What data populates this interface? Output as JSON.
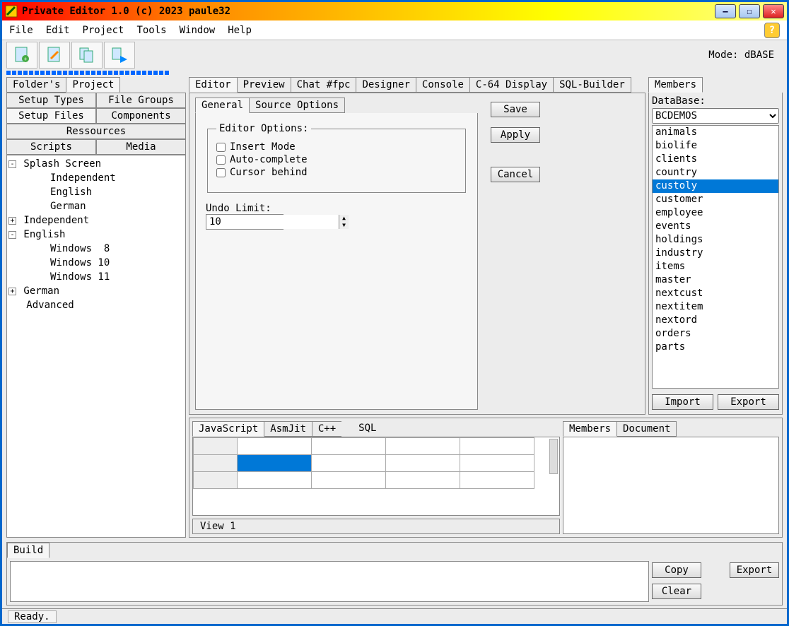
{
  "window": {
    "title": "Private Editor 1.0 (c) 2023 paule32"
  },
  "menu": [
    "File",
    "Edit",
    "Project",
    "Tools",
    "Window",
    "Help"
  ],
  "mode_label": "Mode: dBASE",
  "left": {
    "tabs": [
      "Folder's",
      "Project"
    ],
    "active_tab": 1,
    "buttons_row1": [
      "Setup Types",
      "File Groups"
    ],
    "buttons_row2": [
      "Setup Files",
      "Components"
    ],
    "buttons_row3": [
      "Ressources"
    ],
    "buttons_row4": [
      "Scripts",
      "Media"
    ],
    "tree": [
      {
        "indent": 0,
        "toggle": "-",
        "label": "Splash Screen"
      },
      {
        "indent": 1,
        "toggle": "",
        "label": "Independent"
      },
      {
        "indent": 1,
        "toggle": "",
        "label": "English"
      },
      {
        "indent": 1,
        "toggle": "",
        "label": "German"
      },
      {
        "indent": 0,
        "toggle": "+",
        "label": "Independent"
      },
      {
        "indent": 0,
        "toggle": "-",
        "label": "English"
      },
      {
        "indent": 1,
        "toggle": "",
        "label": "Windows  8"
      },
      {
        "indent": 1,
        "toggle": "",
        "label": "Windows 10"
      },
      {
        "indent": 1,
        "toggle": "",
        "label": "Windows 11"
      },
      {
        "indent": 0,
        "toggle": "+",
        "label": "German"
      },
      {
        "indent": 0,
        "toggle": "",
        "label": "Advanced"
      }
    ]
  },
  "center": {
    "tabs": [
      "Editor",
      "Preview",
      "Chat #fpc",
      "Designer",
      "Console",
      "C-64 Display",
      "SQL-Builder"
    ],
    "inner_tabs": [
      "General",
      "Source Options"
    ],
    "fieldset_title": "Editor Options:",
    "check_insert": "Insert Mode",
    "check_auto": "Auto-complete",
    "check_cursor": "Cursor behind",
    "undo_label": "Undo Limit:",
    "undo_value": "10",
    "btn_save": "Save",
    "btn_apply": "Apply",
    "btn_cancel": "Cancel",
    "lang_tabs": [
      "JavaScript",
      "AsmJit",
      "C++",
      "SQL"
    ],
    "view_tab": "View 1",
    "doc_tabs": [
      "Members",
      "Document"
    ]
  },
  "right": {
    "tab": "Members",
    "db_label": "DataBase:",
    "db_selected": "BCDEMOS",
    "db_items": [
      "animals",
      "biolife",
      "clients",
      "country",
      "custoly",
      "customer",
      "employee",
      "events",
      "holdings",
      "industry",
      "items",
      "master",
      "nextcust",
      "nextitem",
      "nextord",
      "orders",
      "parts"
    ],
    "db_selected_index": 4,
    "btn_import": "Import",
    "btn_export": "Export"
  },
  "build": {
    "tab": "Build",
    "btn_copy": "Copy",
    "btn_clear": "Clear",
    "btn_export": "Export"
  },
  "status": "Ready."
}
